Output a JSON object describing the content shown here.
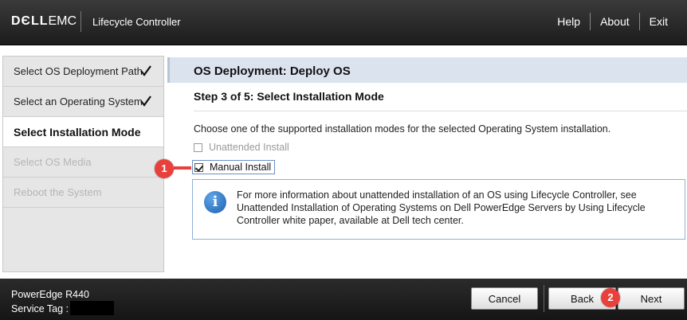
{
  "header": {
    "logo_dell": "DЄLL",
    "logo_emc": "EMC",
    "app_title": "Lifecycle Controller",
    "nav": [
      "Help",
      "About",
      "Exit"
    ]
  },
  "sidebar": {
    "items": [
      {
        "label": "Select OS Deployment Path",
        "state": "done"
      },
      {
        "label": "Select an Operating System",
        "state": "done"
      },
      {
        "label": "Select Installation Mode",
        "state": "active"
      },
      {
        "label": "Select OS Media",
        "state": "disabled"
      },
      {
        "label": "Reboot the System",
        "state": "disabled"
      }
    ]
  },
  "main": {
    "title": "OS Deployment: Deploy OS",
    "step_title": "Step 3 of 5: Select Installation Mode",
    "intro": "Choose one of the supported installation modes for the selected Operating System installation.",
    "options": [
      {
        "label": "Unattended Install",
        "checked": false,
        "enabled": false
      },
      {
        "label": "Manual Install",
        "checked": true,
        "enabled": true
      }
    ],
    "info_icon": "info-icon",
    "info_text": "For more information about unattended installation of an OS using Lifecycle Controller, see Unattended Installation of Operating Systems on Dell PowerEdge Servers by Using Lifecycle Controller white paper, available at Dell tech center."
  },
  "markers": {
    "first": "1",
    "second": "2"
  },
  "footer": {
    "model": "PowerEdge R440",
    "service_tag_label": "Service Tag :",
    "buttons": {
      "cancel": "Cancel",
      "back": "Back",
      "next": "Next"
    }
  },
  "colors": {
    "marker": "#e8413c",
    "header_bg": "#dbe3ee",
    "info_border": "#8fb0d8"
  }
}
